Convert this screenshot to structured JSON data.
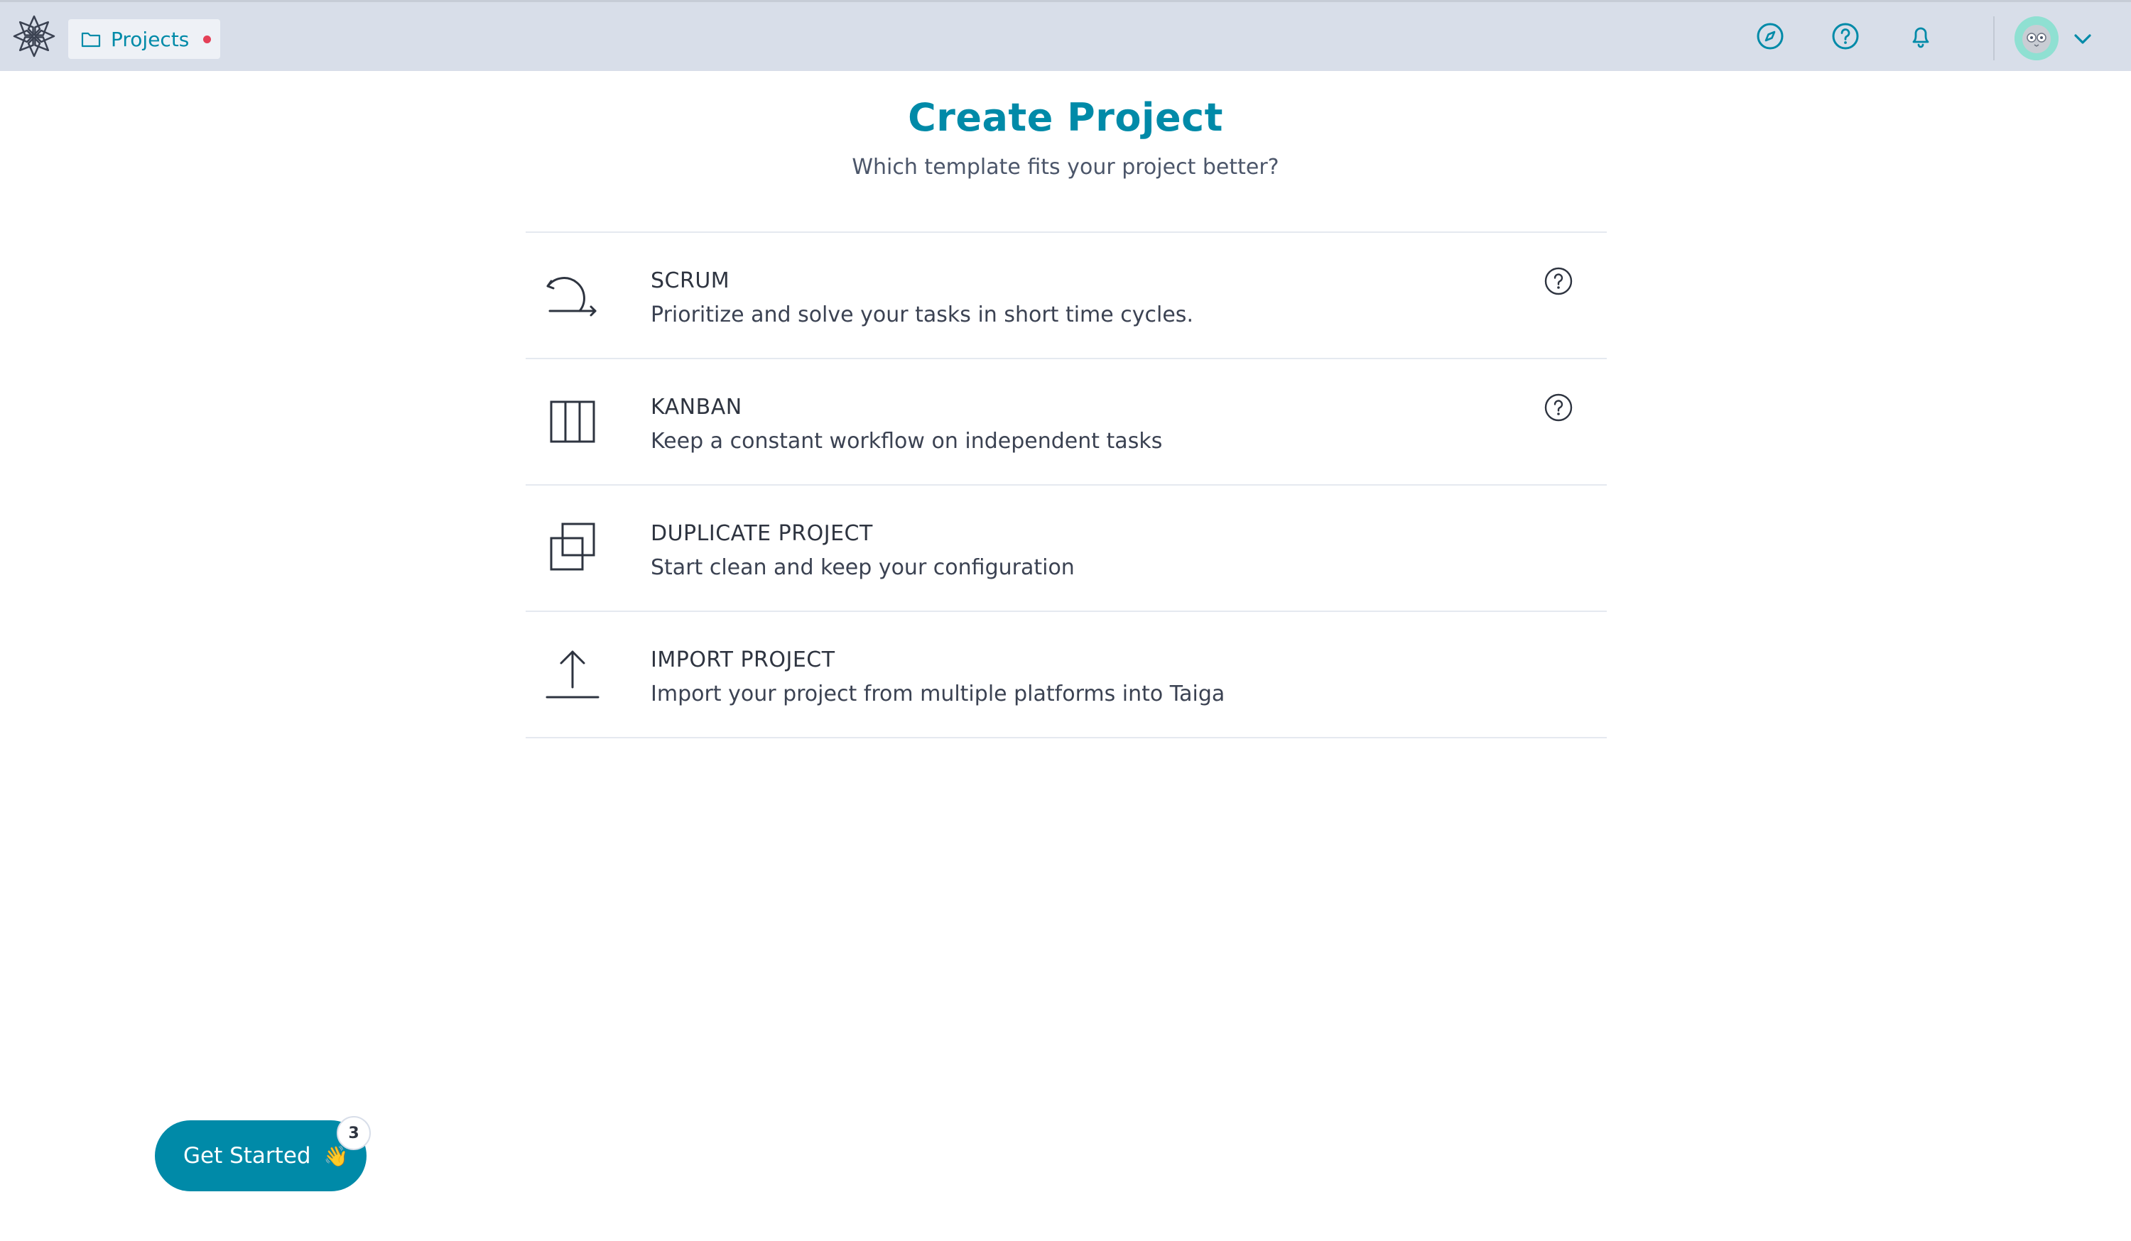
{
  "header": {
    "logo_icon": "taiga-logo-icon",
    "projects_label": "Projects",
    "projects_icon": "folder-icon",
    "notification_dot_color": "#e44057",
    "icons": {
      "discover": "compass-icon",
      "help": "help-circle-icon",
      "notifications": "bell-icon",
      "user_menu": "chevron-down-icon"
    }
  },
  "page": {
    "title": "Create Project",
    "subtitle": "Which template fits your project better?"
  },
  "options": [
    {
      "title": "SCRUM",
      "description": "Prioritize and solve your tasks in short time cycles.",
      "icon": "cycle-arrow-icon",
      "has_help": true
    },
    {
      "title": "KANBAN",
      "description": "Keep a constant workflow on independent tasks",
      "icon": "kanban-columns-icon",
      "has_help": true
    },
    {
      "title": "DUPLICATE PROJECT",
      "description": "Start clean and keep your configuration",
      "icon": "duplicate-icon",
      "has_help": false
    },
    {
      "title": "IMPORT PROJECT",
      "description": "Import your project from multiple platforms into Taiga",
      "icon": "upload-icon",
      "has_help": false
    }
  ],
  "get_started": {
    "label": "Get Started",
    "emoji": "👋",
    "badge_count": "3"
  },
  "colors": {
    "accent": "#008aa8",
    "topbar": "#d8dee9",
    "divider": "#e5e9f0"
  }
}
